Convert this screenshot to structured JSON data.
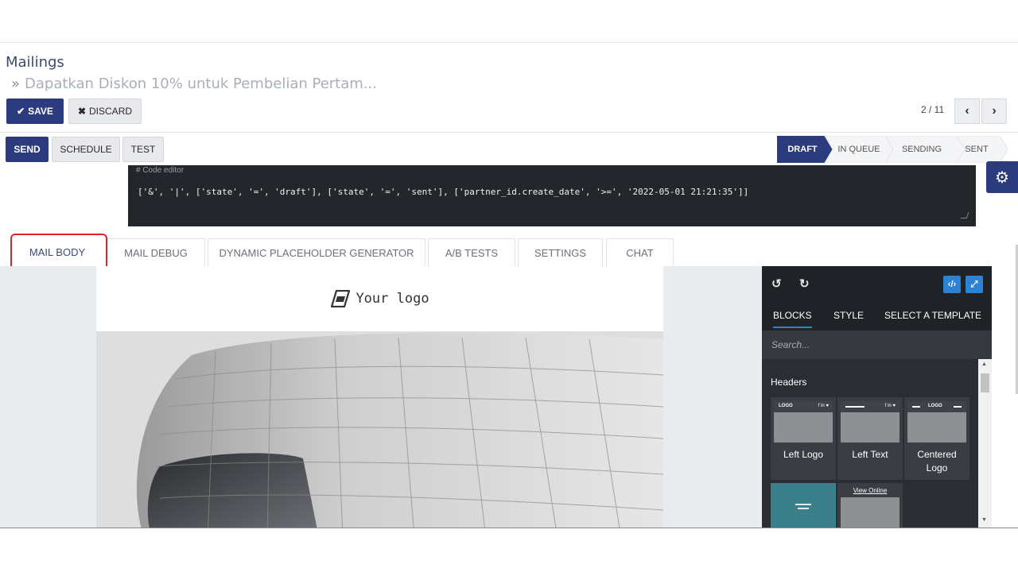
{
  "breadcrumb": {
    "root": "Mailings",
    "separator": "»",
    "current": "Dapatkan Diskon 10% untuk Pembelian Pertam..."
  },
  "toolbar": {
    "save_label": "SAVE",
    "discard_label": "DISCARD",
    "save_icon": "check-icon",
    "discard_icon": "times-icon"
  },
  "pager": {
    "text": "2 / 11",
    "prev_icon": "chevron-left-icon",
    "next_icon": "chevron-right-icon"
  },
  "actions": {
    "send": "SEND",
    "schedule": "SCHEDULE",
    "test": "TEST"
  },
  "statusbar": {
    "stages": [
      "DRAFT",
      "IN QUEUE",
      "SENDING",
      "SENT"
    ],
    "active": "DRAFT"
  },
  "code_editor": {
    "caption": "# Code editor",
    "code": "['&', '|', ['state', '=', 'draft'], ['state', '=', 'sent'], ['partner_id.create_date', '>=', '2022-05-01 21:21:35']]"
  },
  "tabs": [
    "MAIL BODY",
    "MAIL DEBUG",
    "DYNAMIC PLACEHOLDER GENERATOR",
    "A/B TESTS",
    "SETTINGS",
    "CHAT"
  ],
  "active_tab": "MAIL BODY",
  "mail": {
    "logo_text": "Your logo"
  },
  "panel": {
    "tabs": [
      "BLOCKS",
      "STYLE",
      "SELECT A TEMPLATE"
    ],
    "search_placeholder": "Search...",
    "section": "Headers",
    "blocks": [
      {
        "label": "Left Logo",
        "thumb_left": "LOGO",
        "thumb_right": "f in ♥"
      },
      {
        "label": "Left Text",
        "thumb_left": "",
        "thumb_right": "f in ♥"
      },
      {
        "label": "Centered Logo",
        "thumb_left": "",
        "thumb_right": "LOGO"
      },
      {
        "label": "",
        "thumb_left": "",
        "thumb_right": ""
      },
      {
        "label": "",
        "thumb_left": "View Online",
        "thumb_right": ""
      }
    ]
  },
  "colors": {
    "primary": "#2c3b7d",
    "accent_blue": "#2d82d3",
    "highlight": "#e0242a"
  }
}
